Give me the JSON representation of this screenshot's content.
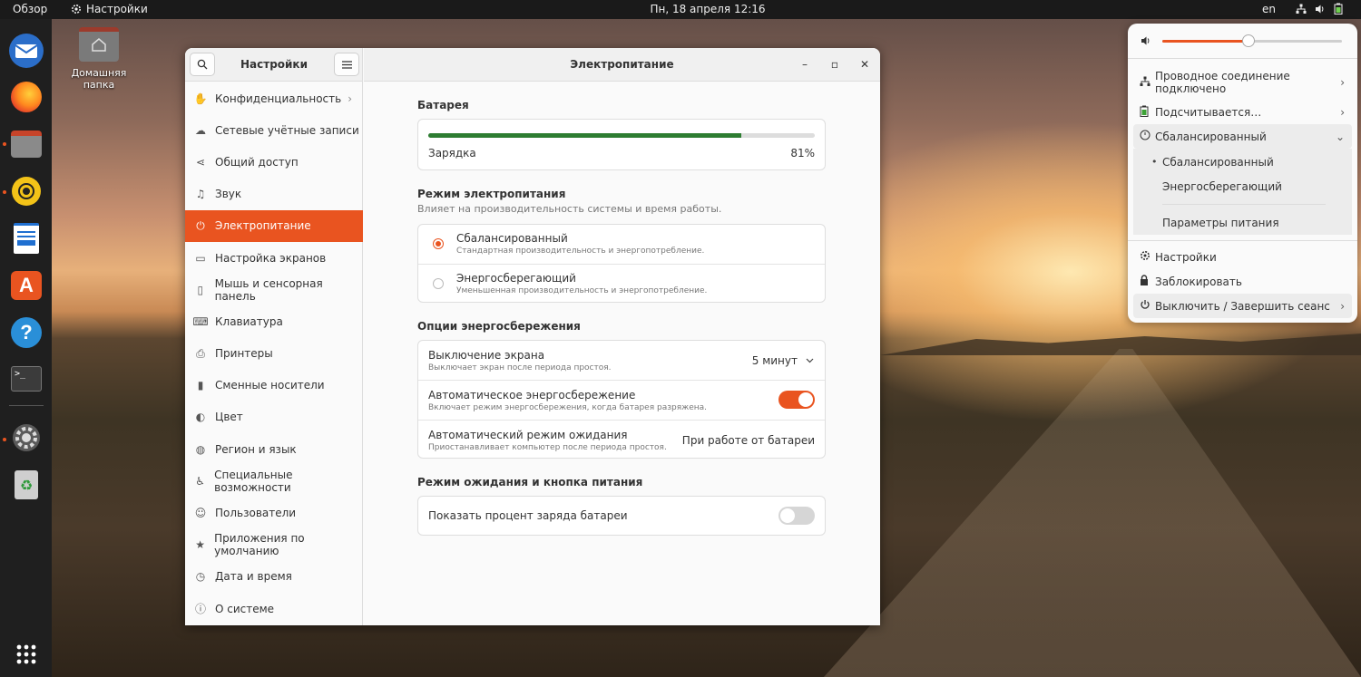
{
  "topbar": {
    "overview": "Обзор",
    "app_name": "Настройки",
    "clock": "Пн, 18 апреля  12:16",
    "lang": "en"
  },
  "desktop": {
    "home_folder": "Домашняя папка"
  },
  "window": {
    "sidebar_title": "Настройки",
    "title": "Электропитание",
    "sidebar_items": [
      {
        "label": "Конфиденциальность",
        "icon": "hand-icon",
        "chevron": true
      },
      {
        "label": "Сетевые учётные записи",
        "icon": "cloud-icon"
      },
      {
        "label": "Общий доступ",
        "icon": "share-icon"
      },
      {
        "label": "Звук",
        "icon": "music-note-icon"
      },
      {
        "label": "Электропитание",
        "icon": "power-icon",
        "active": true
      },
      {
        "label": "Настройка экранов",
        "icon": "display-icon"
      },
      {
        "label": "Мышь и сенсорная панель",
        "icon": "mouse-icon"
      },
      {
        "label": "Клавиатура",
        "icon": "keyboard-icon"
      },
      {
        "label": "Принтеры",
        "icon": "printer-icon"
      },
      {
        "label": "Сменные носители",
        "icon": "usb-drive-icon"
      },
      {
        "label": "Цвет",
        "icon": "color-icon"
      },
      {
        "label": "Регион и язык",
        "icon": "globe-icon"
      },
      {
        "label": "Специальные возможности",
        "icon": "accessibility-icon"
      },
      {
        "label": "Пользователи",
        "icon": "users-icon"
      },
      {
        "label": "Приложения по умолчанию",
        "icon": "star-icon"
      },
      {
        "label": "Дата и время",
        "icon": "clock-icon"
      },
      {
        "label": "О системе",
        "icon": "info-icon"
      }
    ]
  },
  "battery": {
    "section_title": "Батарея",
    "status": "Зарядка",
    "percent": "81%",
    "level": 0.81,
    "bar_color": "#2e7d32"
  },
  "power_mode": {
    "section_title": "Режим электропитания",
    "section_sub": "Влияет на производительность системы и время работы.",
    "options": [
      {
        "title": "Сбалансированный",
        "desc": "Стандартная производительность и энергопотребление.",
        "selected": true
      },
      {
        "title": "Энергосберегающий",
        "desc": "Уменьшенная производительность и энергопотребление.",
        "selected": false
      }
    ]
  },
  "power_saving": {
    "section_title": "Опции энергосбережения",
    "screen_off": {
      "title": "Выключение экрана",
      "desc": "Выключает экран после периода простоя.",
      "value": "5 минут"
    },
    "auto_saver": {
      "title": "Автоматическое энергосбережение",
      "desc": "Включает режим энергосбережения, когда батарея разряжена.",
      "enabled": true
    },
    "auto_suspend": {
      "title": "Автоматический режим ожидания",
      "desc": "Приостанавливает компьютер после периода простоя.",
      "value": "При работе от батареи"
    }
  },
  "suspend_button": {
    "section_title": "Режим ожидания и кнопка питания",
    "show_percent": {
      "title": "Показать процент заряда батареи",
      "enabled": false
    }
  },
  "system_menu": {
    "volume_level": 0.48,
    "network": "Проводное соединение подключено",
    "battery": "Подсчитывается…",
    "power_profile": "Сбалансированный",
    "profile_options": [
      "Сбалансированный",
      "Энергосберегающий"
    ],
    "power_settings": "Параметры питания",
    "settings": "Настройки",
    "lock": "Заблокировать",
    "power_off": "Выключить / Завершить сеанс"
  },
  "colors": {
    "accent": "#e95420",
    "topbar": "#1a1a1a",
    "dock": "#1f1f1f"
  }
}
